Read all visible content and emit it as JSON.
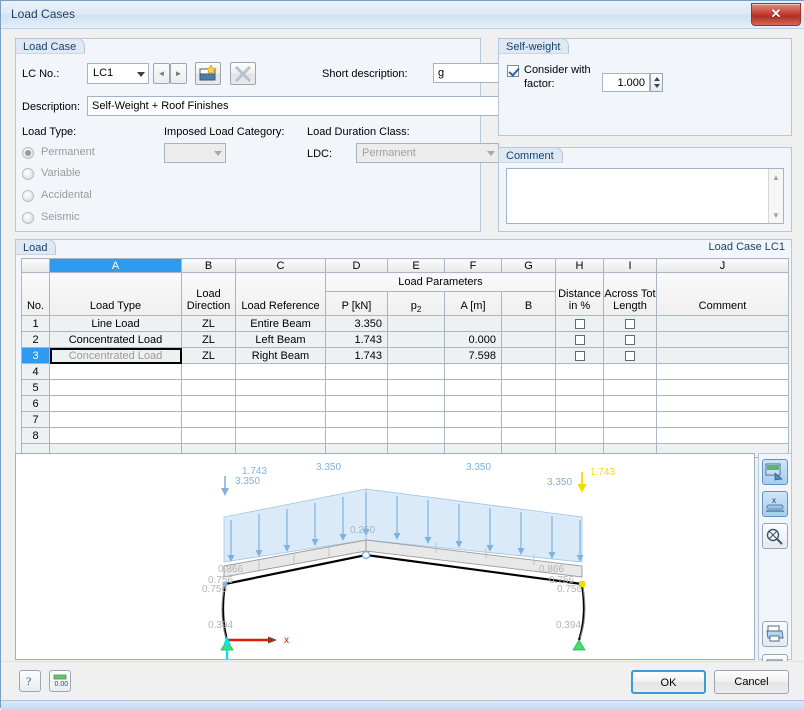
{
  "window": {
    "title": "Load Cases",
    "close_label": "✕"
  },
  "load_case": {
    "group_title": "Load Case",
    "lc_no_label": "LC No.:",
    "lc_no_value": "LC1",
    "prev_label": "◄",
    "next_label": "►",
    "new_icon": "new-load-case-icon",
    "delete_icon": "delete-load-case-icon",
    "short_description_label": "Short description:",
    "short_description_value": "g",
    "description_label": "Description:",
    "description_value": "Self-Weight + Roof Finishes",
    "load_type_label": "Load Type:",
    "load_types": [
      {
        "label": "Permanent",
        "selected": true
      },
      {
        "label": "Variable",
        "selected": false
      },
      {
        "label": "Accidental",
        "selected": false
      },
      {
        "label": "Seismic",
        "selected": false
      }
    ],
    "imposed_label": "Imposed Load Category:",
    "imposed_value": "",
    "ldc_group_label": "Load Duration Class:",
    "ldc_label": "LDC:",
    "ldc_value": "Permanent"
  },
  "self_weight": {
    "group_title": "Self-weight",
    "consider_label_line1": "Consider with",
    "consider_label_line2": "factor:",
    "consider_checked": true,
    "factor_value": "1.000"
  },
  "comment": {
    "group_title": "Comment",
    "value": "",
    "scroll_up": "▲",
    "scroll_down": "▼"
  },
  "load_table": {
    "group_title": "Load",
    "right_label": "Load Case LC1",
    "selected_column": "A",
    "selected_row": 3,
    "column_letters": [
      "",
      "A",
      "B",
      "C",
      "D",
      "E",
      "F",
      "G",
      "H",
      "I",
      "J"
    ],
    "group_header": "Load Parameters",
    "headers": [
      "No.",
      "Load Type",
      "Load\nDirection",
      "Load Reference",
      "P [kN]",
      "p2",
      "A [m]",
      "B",
      "Distance\nin %",
      "Across Tot\nLength",
      "Comment"
    ],
    "headers_flat": {
      "no": "No.",
      "load_type": "Load Type",
      "load_direction_1": "Load",
      "load_direction_2": "Direction",
      "load_reference": "Load Reference",
      "p_kn": "P [kN]",
      "p2": "p",
      "p2_sub": "2",
      "a_m": "A [m]",
      "b": "B",
      "distance_1": "Distance",
      "distance_2": "in %",
      "across_1": "Across Tot",
      "across_2": "Length",
      "comment": "Comment"
    },
    "rows": [
      {
        "no": "1",
        "load_type": "Line Load",
        "direction": "ZL",
        "reference": "Entire Beam",
        "p": "3.350",
        "p2": "",
        "a": "",
        "b": "",
        "distance": false,
        "across": false,
        "comment": "",
        "selected": false
      },
      {
        "no": "2",
        "load_type": "Concentrated Load",
        "direction": "ZL",
        "reference": "Left Beam",
        "p": "1.743",
        "p2": "",
        "a": "0.000",
        "b": "",
        "distance": false,
        "across": false,
        "comment": "",
        "selected": false
      },
      {
        "no": "3",
        "load_type": "Concentrated Load",
        "direction": "ZL",
        "reference": "Right Beam",
        "p": "1.743",
        "p2": "",
        "a": "7.598",
        "b": "",
        "distance": false,
        "across": false,
        "comment": "",
        "selected": true
      },
      {
        "no": "4",
        "load_type": "",
        "direction": "",
        "reference": "",
        "p": "",
        "p2": "",
        "a": "",
        "b": "",
        "distance": null,
        "across": null,
        "comment": "",
        "selected": false
      },
      {
        "no": "5",
        "load_type": "",
        "direction": "",
        "reference": "",
        "p": "",
        "p2": "",
        "a": "",
        "b": "",
        "distance": null,
        "across": null,
        "comment": "",
        "selected": false
      },
      {
        "no": "6",
        "load_type": "",
        "direction": "",
        "reference": "",
        "p": "",
        "p2": "",
        "a": "",
        "b": "",
        "distance": null,
        "across": null,
        "comment": "",
        "selected": false
      },
      {
        "no": "7",
        "load_type": "",
        "direction": "",
        "reference": "",
        "p": "",
        "p2": "",
        "a": "",
        "b": "",
        "distance": null,
        "across": null,
        "comment": "",
        "selected": false
      },
      {
        "no": "8",
        "load_type": "",
        "direction": "",
        "reference": "",
        "p": "",
        "p2": "",
        "a": "",
        "b": "",
        "distance": null,
        "across": null,
        "comment": "",
        "selected": false
      }
    ]
  },
  "diagram": {
    "axis_x_label": "x",
    "load_labels": [
      {
        "text": "1.743",
        "color": "#7fb2e0"
      },
      {
        "text": "3.350",
        "color": "#7fb2e0"
      },
      {
        "text": "3.350",
        "color": "#7fb2e0"
      },
      {
        "text": "3.350",
        "color": "#7fb2e0"
      },
      {
        "text": "3.350",
        "color": "#7fb2e0"
      },
      {
        "text": "1.743",
        "color": "#f2dd00"
      },
      {
        "text": "0.250",
        "color": "#9fb6c9"
      },
      {
        "text": "0.866",
        "color": "#b4b4b4"
      },
      {
        "text": "0.756",
        "color": "#b4b4b4"
      },
      {
        "text": "0.756",
        "color": "#b4b4b4"
      },
      {
        "text": "0.866",
        "color": "#b4b4b4"
      },
      {
        "text": "0.756",
        "color": "#b4b4b4"
      },
      {
        "text": "0.756",
        "color": "#b4b4b4"
      },
      {
        "text": "0.394",
        "color": "#b4b4b4"
      },
      {
        "text": "0.394",
        "color": "#b4b4b4"
      }
    ],
    "colors": {
      "load_blue": "#7fb2e0",
      "load_fill": "#d6e7f7",
      "highlight_yellow": "#f2dd00",
      "support_green": "#44e06a",
      "axis_x_red": "#e01b00",
      "axis_z_cyan": "#00e5e5",
      "member_black": "#000000",
      "member_gray": "#9a9a9a"
    },
    "toolbar": [
      {
        "icon": "render-view-icon",
        "active": true
      },
      {
        "icon": "section-view-icon",
        "active": true
      },
      {
        "icon": "zoom-reset-icon",
        "active": false
      },
      {
        "icon": "print-icon",
        "active": false
      },
      {
        "icon": "print-preview-icon",
        "active": false
      }
    ]
  },
  "footer": {
    "help_icon": "help-icon",
    "units_icon": "units-icon",
    "units_label": "0.00",
    "ok_label": "OK",
    "cancel_label": "Cancel"
  }
}
